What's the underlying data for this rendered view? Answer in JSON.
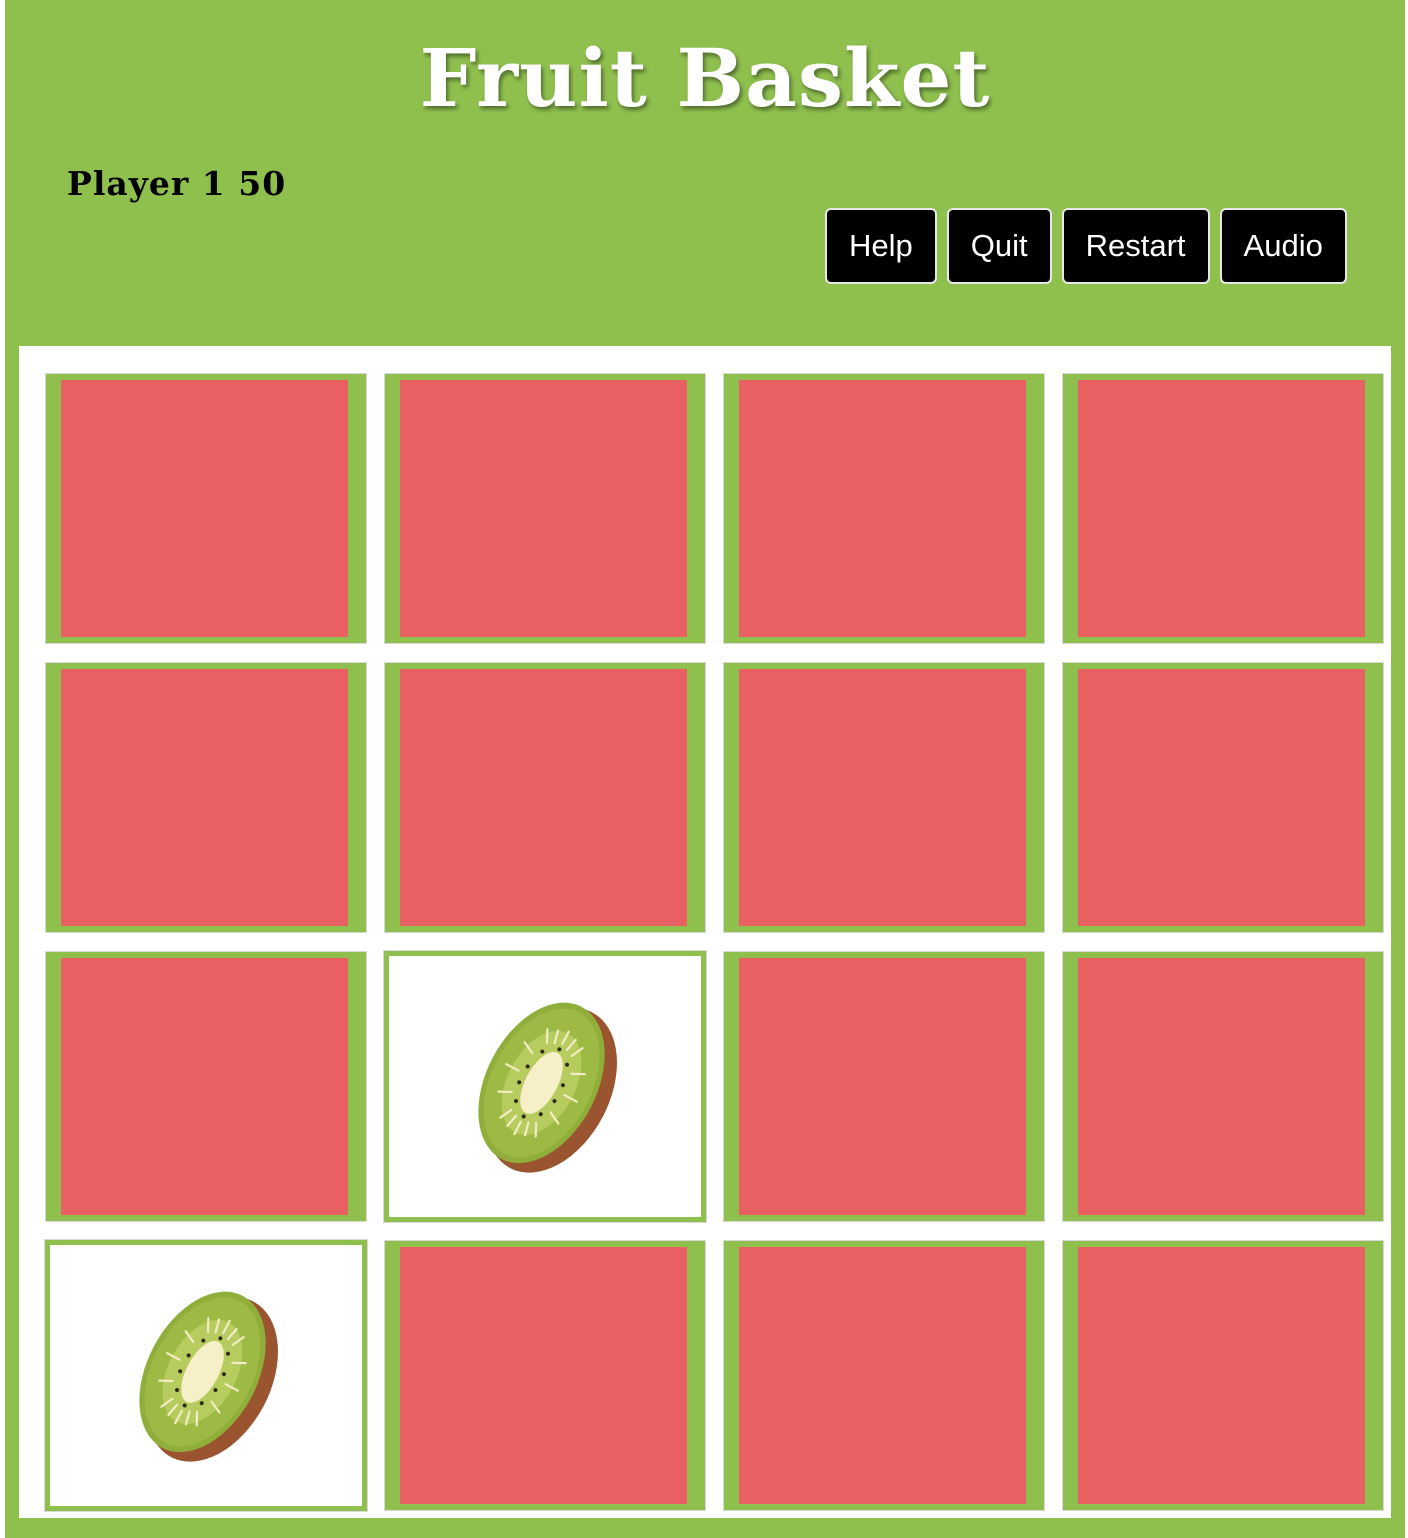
{
  "header": {
    "title": "Fruit Basket",
    "score_text": "Player 1 50"
  },
  "controls": {
    "help": "Help",
    "quit": "Quit",
    "restart": "Restart",
    "audio": "Audio"
  },
  "board": {
    "rows": 4,
    "columns": 4,
    "cards": [
      {
        "state": "face-down"
      },
      {
        "state": "face-down"
      },
      {
        "state": "face-down"
      },
      {
        "state": "face-down"
      },
      {
        "state": "face-down"
      },
      {
        "state": "face-down"
      },
      {
        "state": "face-down"
      },
      {
        "state": "face-down"
      },
      {
        "state": "face-down"
      },
      {
        "state": "face-up",
        "fruit": "kiwi-icon"
      },
      {
        "state": "face-down"
      },
      {
        "state": "face-down"
      },
      {
        "state": "face-up",
        "fruit": "kiwi-icon"
      },
      {
        "state": "face-down"
      },
      {
        "state": "face-down"
      },
      {
        "state": "face-down"
      }
    ]
  },
  "colors": {
    "background": "#8fc04e",
    "card_back": "#e86062",
    "board": "#ffffff",
    "button": "#000000"
  }
}
